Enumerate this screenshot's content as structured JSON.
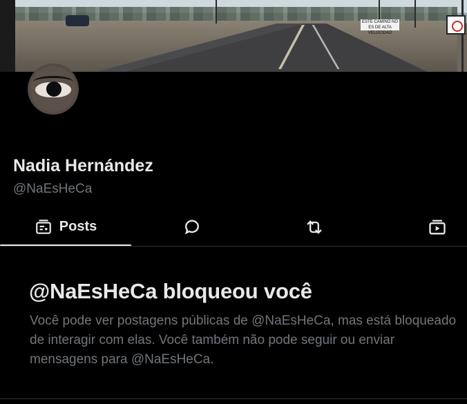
{
  "profile": {
    "banner_sign_text": "ESTE CAMINO NO ES DE ALTA VELOCIDAD",
    "name": "Nadia Hernández",
    "handle": "@NaEsHeCa"
  },
  "tabs": [
    {
      "label": "Posts",
      "icon": "posts-icon",
      "selected": true
    },
    {
      "label": "",
      "icon": "reply-icon",
      "selected": false
    },
    {
      "label": "",
      "icon": "repost-icon",
      "selected": false
    },
    {
      "label": "",
      "icon": "media-icon",
      "selected": false
    }
  ],
  "blocked": {
    "title": "@NaEsHeCa bloqueou você",
    "message": "Você pode ver postagens públicas de @NaEsHeCa, mas está bloqueado de interagir com elas. Você também não pode seguir ou enviar mensagens para @NaEsHeCa."
  },
  "colors": {
    "background": "#000000",
    "text_primary": "#e7e9ea",
    "text_secondary": "#71767b",
    "divider": "#2f3336"
  }
}
